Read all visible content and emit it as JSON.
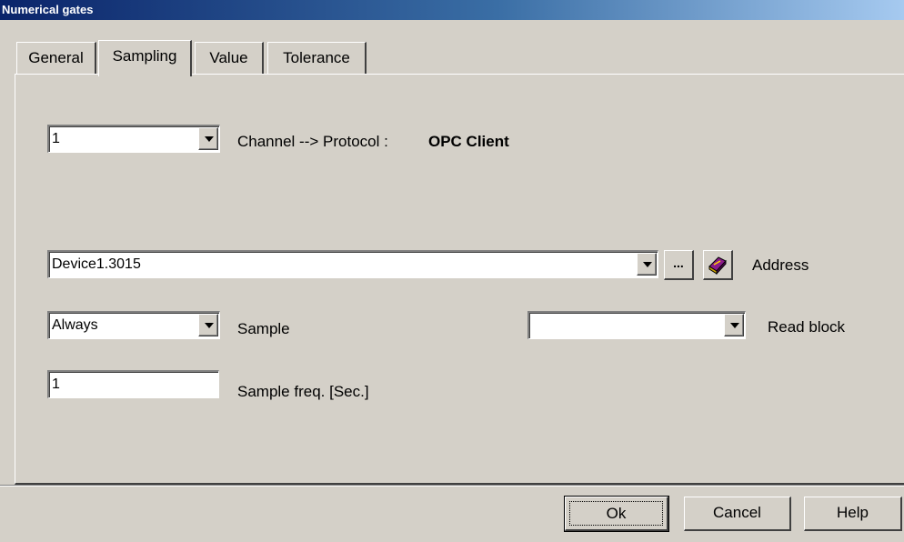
{
  "window": {
    "title": "Numerical gates"
  },
  "tabs": [
    {
      "label": "General"
    },
    {
      "label": "Sampling"
    },
    {
      "label": "Value"
    },
    {
      "label": "Tolerance"
    }
  ],
  "sampling": {
    "channel": {
      "value": "1"
    },
    "channel_label": "Channel --> Protocol :",
    "protocol_value": "OPC Client",
    "address": {
      "value": "Device1.3015",
      "label": "Address",
      "browse_label": "..."
    },
    "sample": {
      "value": "Always",
      "label": "Sample"
    },
    "read_block": {
      "value": "",
      "label": "Read block"
    },
    "sample_freq": {
      "value": "1",
      "label": "Sample freq. [Sec.]"
    }
  },
  "buttons": {
    "ok": "Ok",
    "cancel": "Cancel",
    "help": "Help"
  },
  "icons": {
    "address_book": "address-book-icon",
    "dropdown": "chevron-down-icon"
  }
}
